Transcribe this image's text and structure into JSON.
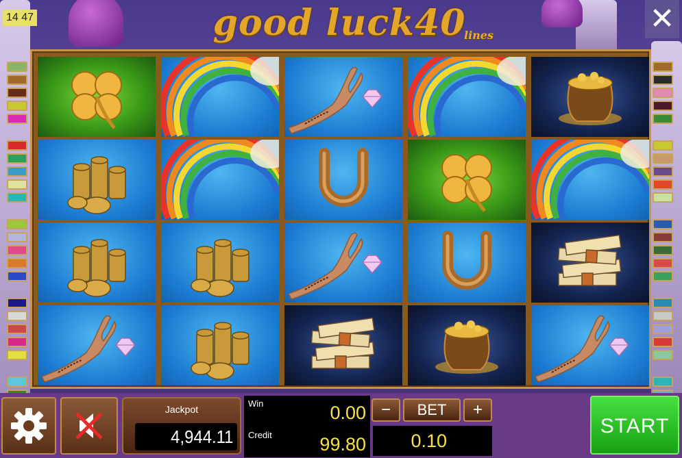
{
  "clock": "14 47",
  "logo": {
    "title": "good luck40",
    "subtitle": "lines"
  },
  "reels": [
    [
      "clover",
      "coins",
      "coins",
      "hand-diamond"
    ],
    [
      "rainbow",
      "rainbow",
      "coins",
      "coins"
    ],
    [
      "hand-diamond",
      "horseshoe",
      "hand-diamond",
      "money-stack"
    ],
    [
      "rainbow",
      "clover",
      "horseshoe",
      "gold-pot"
    ],
    [
      "gold-pot",
      "rainbow",
      "money-stack",
      "hand-diamond"
    ]
  ],
  "marker_colors_left": [
    "#8ab46a",
    "#a06a2a",
    "#6a2a1a",
    "#c8c830",
    "#d82ab4",
    "#d82a2a",
    "#2aa05a",
    "#3a9ac8",
    "#e0e0a0",
    "#2ab4b4",
    "#9ac83a",
    "#b4b4e0",
    "#e04a8a",
    "#d87a2a",
    "#2a4ac8",
    "#1a1a8a",
    "#d8d8d8",
    "#c84a4a",
    "#d82a8a",
    "#e0e040",
    "#5ac8d8",
    "#2a8a2a",
    "#1a2a9a"
  ],
  "marker_colors_right": [
    "#a06a2a",
    "#2a2a2a",
    "#e08ab4",
    "#4a1a2a",
    "#3a8a3a",
    "#c8c830",
    "#c89a6a",
    "#6a4a8a",
    "#e04a2a",
    "#c8e0a0",
    "#2a5ab4",
    "#8a3a3a",
    "#3a6a3a",
    "#d84a4a",
    "#3aa05a",
    "#2a8ab4",
    "#c8c8c8",
    "#a0a0d8",
    "#d83a3a",
    "#8ac8a0",
    "#2ab4b4",
    "#6ab4c8",
    "#1a1a9a"
  ],
  "bottom": {
    "jackpot_label": "Jackpot",
    "jackpot_value": "4,944.11",
    "win_label": "Win",
    "win_value": "0.00",
    "credit_label": "Credit",
    "credit_value": "99.80",
    "bet_minus": "−",
    "bet_label": "BET",
    "bet_plus": "+",
    "bet_value": "0.10",
    "start_label": "START"
  },
  "colors": {
    "accent_gold": "#e3a629",
    "start_green": "#2ec828",
    "value_yellow": "#f7e24a"
  },
  "icons": {
    "settings": "gear-icon",
    "sound": "speaker-muted-icon",
    "close": "close-icon"
  }
}
